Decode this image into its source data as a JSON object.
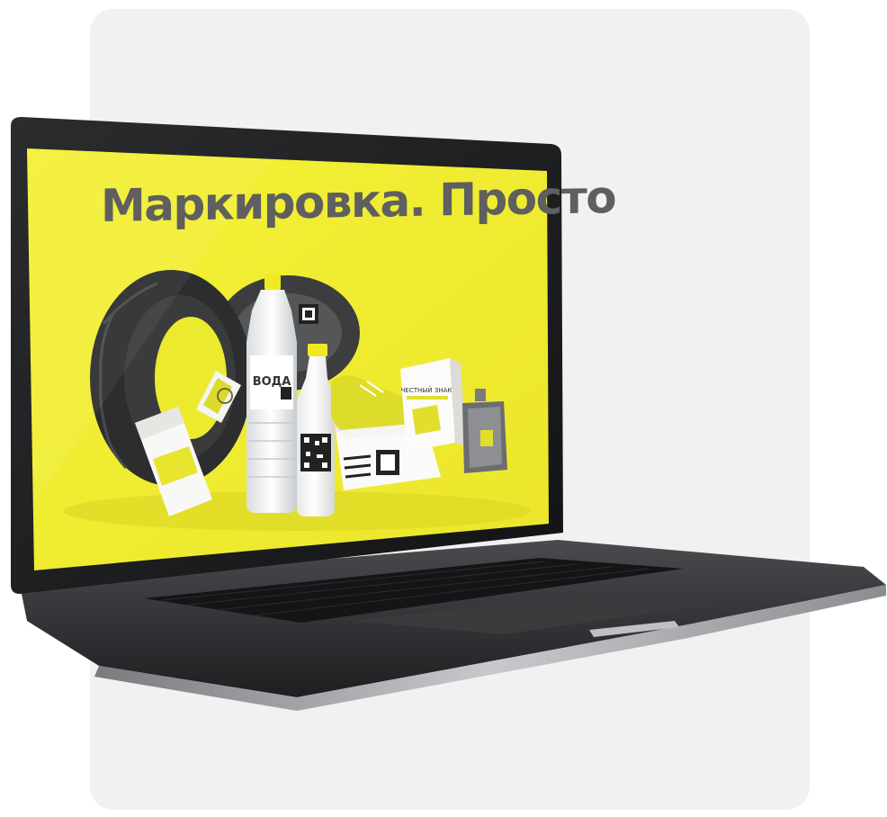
{
  "screen": {
    "headline": "Маркировка. Просто",
    "background_color": "#f2ef34",
    "text_color": "#5f5f5f"
  },
  "products": {
    "water_label": "ВОДА",
    "box_label": "ЧЕСТНЫЙ ЗНАК"
  },
  "card_color": "#f1f1f1"
}
